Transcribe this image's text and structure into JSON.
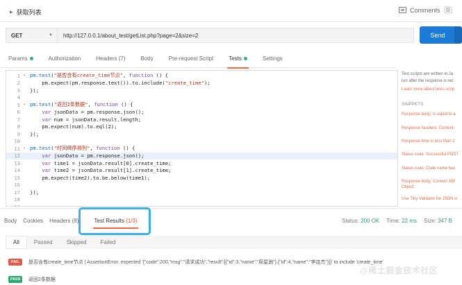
{
  "header": {
    "request_name": "获取列表",
    "comments_label": "Comments",
    "comments_count": "0"
  },
  "request": {
    "method": "GET",
    "url": "http://127.0.0.1/about_test/getList.php?page=2&size=2",
    "send_label": "Send"
  },
  "tabs": [
    {
      "label": "Params",
      "dot": true
    },
    {
      "label": "Authorization",
      "dot": false
    },
    {
      "label": "Headers (7)",
      "dot": false
    },
    {
      "label": "Body",
      "dot": false
    },
    {
      "label": "Pre-request Script",
      "dot": false
    },
    {
      "label": "Tests",
      "dot": true,
      "active": true
    },
    {
      "label": "Settings",
      "dot": false
    }
  ],
  "editor": {
    "lines": [
      {
        "n": "1",
        "fold": true,
        "text": "pm.test(\"是否含有create_time节点\", function () {"
      },
      {
        "n": "2",
        "fold": false,
        "text": "    pm.expect(pm.response.text()).to.include(\"create_time\");"
      },
      {
        "n": "3",
        "fold": false,
        "text": "});"
      },
      {
        "n": "4",
        "fold": false,
        "text": ""
      },
      {
        "n": "5",
        "fold": true,
        "text": "pm.test(\"返回2条数据\", function () {"
      },
      {
        "n": "6",
        "fold": false,
        "text": "    var jsonData = pm.response.json();"
      },
      {
        "n": "7",
        "fold": false,
        "text": "    var num = jsonData.result.length;"
      },
      {
        "n": "8",
        "fold": false,
        "text": "    pm.expect(num).to.eql(2);"
      },
      {
        "n": "9",
        "fold": false,
        "text": "});"
      },
      {
        "n": "10",
        "fold": false,
        "text": ""
      },
      {
        "n": "11",
        "fold": true,
        "text": "pm.test(\"时间倒序排列\", function () {"
      },
      {
        "n": "12",
        "fold": false,
        "text": "    var jsonData = pm.response.json();",
        "highlight": true
      },
      {
        "n": "13",
        "fold": false,
        "text": "    var time1 = jsonData.result[0].create_time;"
      },
      {
        "n": "14",
        "fold": false,
        "text": "    var time2 = jsonData.result[1].create_time;"
      },
      {
        "n": "15",
        "fold": false,
        "text": "    pm.expect(time2).to.be.below(time1);"
      },
      {
        "n": "16",
        "fold": false,
        "text": ""
      },
      {
        "n": "17",
        "fold": false,
        "text": "});"
      },
      {
        "n": "18",
        "fold": false,
        "text": ""
      },
      {
        "n": "19",
        "fold": false,
        "text": ""
      }
    ]
  },
  "side": {
    "intro_1": "Test scripts are written in Ja",
    "intro_2": "run after the response is rec",
    "learn_more": "Learn more about tests scrip",
    "snippets_heading": "SNIPPETS",
    "snippets": [
      "Response body: Is equal to a",
      "Response headers: Content-",
      "Response time is less than 2",
      "Status code: Successful POST",
      "Status code: Code name has",
      "Response body: Convert XM",
      "Object",
      "Use Tiny Validator for JSON d"
    ]
  },
  "response": {
    "tabs": [
      "Body",
      "Cookies",
      "Headers (8)"
    ],
    "results_label": "Test Results",
    "results_count": "(1/3)",
    "status_label": "Status:",
    "status_value": "200 OK",
    "time_label": "Time:",
    "time_value": "22 ms",
    "size_label": "Size:",
    "size_value": "347 B"
  },
  "filters": [
    "All",
    "Passed",
    "Skipped",
    "Failed"
  ],
  "results": [
    {
      "status": "FAIL",
      "text": "是否含有create_time节点 | AssertionError: expected '{\"code\":200,\"msg\":\"请求成功\",\"result\":[{\"id\":3,\"name\":\"周星驰\"},{\"id\":4,\"name\":\"李连杰\"}]}' to include 'create_time'"
    },
    {
      "status": "PASS",
      "text": "返回2条数据"
    }
  ],
  "watermark": "@稀土掘金技术社区"
}
